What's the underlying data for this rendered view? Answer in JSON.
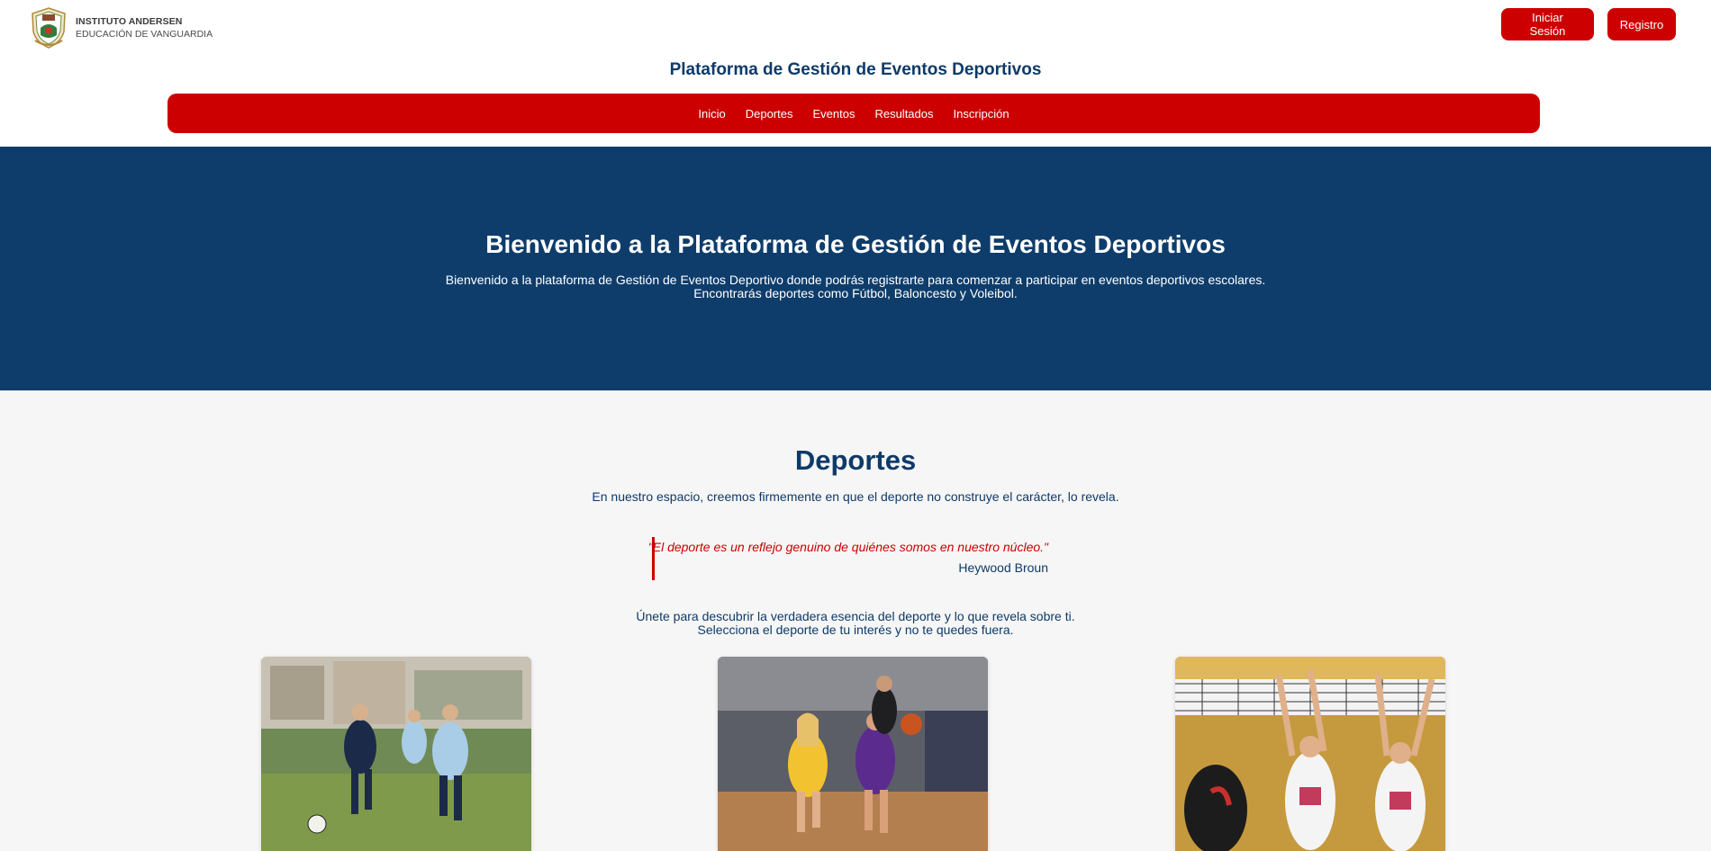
{
  "header": {
    "logo_name": "INSTITUTO ANDERSEN",
    "logo_tagline": "EDUCACIÓN DE VANGUARDIA",
    "login_label": "Iniciar Sesión",
    "register_label": "Registro",
    "site_title": "Plataforma de Gestión de Eventos Deportivos"
  },
  "nav": {
    "items": [
      {
        "label": "Inicio"
      },
      {
        "label": "Deportes"
      },
      {
        "label": "Eventos"
      },
      {
        "label": "Resultados"
      },
      {
        "label": "Inscripción"
      }
    ]
  },
  "hero": {
    "title": "Bienvenido a la Plataforma de Gestión de Eventos Deportivos",
    "text": "Bienvenido a la plataforma de Gestión de Eventos Deportivo donde podrás registrarte para comenzar a participar en eventos deportivos escolares. Encontrarás deportes como Fútbol, Baloncesto y Voleibol."
  },
  "sports": {
    "title": "Deportes",
    "intro": "En nuestro espacio, creemos firmemente en que el deporte no construye el carácter, lo revela.",
    "quote": "\"El deporte es un reflejo genuino de quiénes somos en nuestro núcleo.\"",
    "quote_author": "Heywood Broun",
    "cta_line1": "Únete para descubrir la verdadera esencia del deporte y lo que revela sobre ti.",
    "cta_line2": "Selecciona el deporte de tu interés y no te quedes fuera.",
    "cards": [
      {
        "image": "football-photo"
      },
      {
        "image": "basketball-photo"
      },
      {
        "image": "volleyball-photo"
      }
    ]
  },
  "colors": {
    "brand_red": "#cc0000",
    "brand_navy": "#0e3d6b"
  }
}
